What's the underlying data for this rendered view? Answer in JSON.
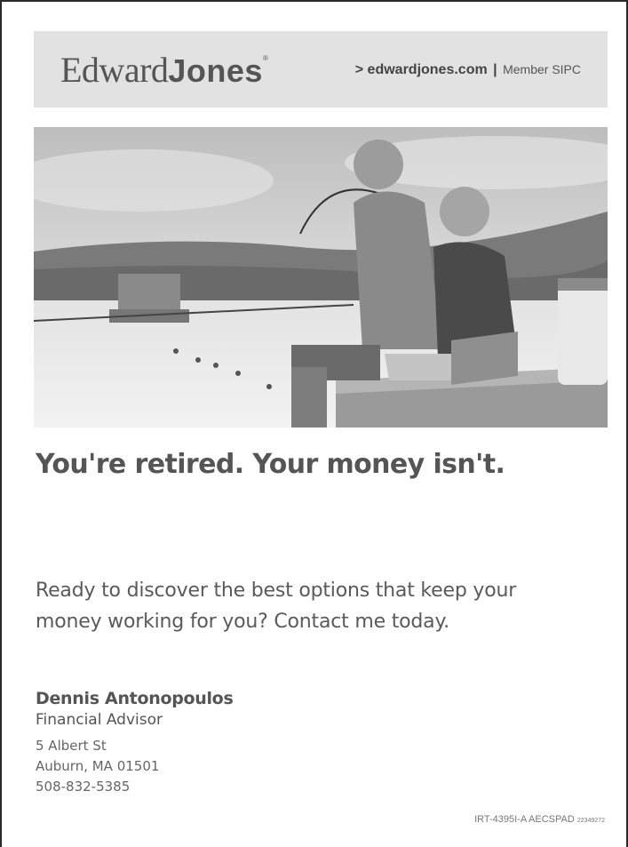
{
  "header": {
    "logo_edward": "Edward",
    "logo_jones": "Jones",
    "logo_reg": "®",
    "link_prefix": "> ",
    "link_url": "edwardjones.com",
    "link_separator": " | ",
    "member_text": "Member SIPC"
  },
  "headline": "You're retired. Your money isn't.",
  "body": {
    "line1": "Ready to discover the best options that keep your",
    "line2": "money working for you? Contact me today."
  },
  "contact": {
    "name": "Dennis Antonopoulos",
    "title": "Financial Advisor",
    "street": "5 Albert St",
    "city": "Auburn, MA 01501",
    "phone": "508-832-5385"
  },
  "footer": {
    "code": "IRT-4395I-A AECSPAD ",
    "code_small": "22349272"
  },
  "colors": {
    "header_bg": "#e2e2e2",
    "text": "#555555",
    "border": "#2a2a2a"
  }
}
